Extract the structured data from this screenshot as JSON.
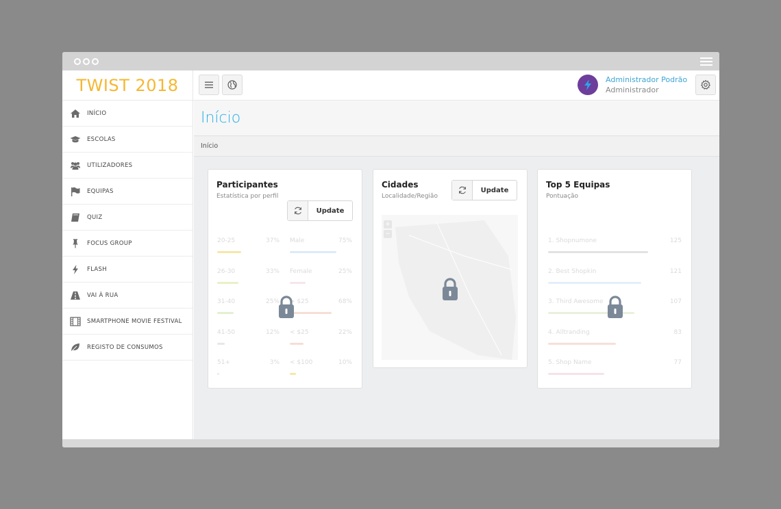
{
  "app": {
    "brand": "TWIST 2018"
  },
  "user": {
    "name": "Administrador Podrão",
    "role": "Administrador"
  },
  "sidebar": {
    "items": [
      {
        "label": "INÍCIO",
        "icon": "home-icon"
      },
      {
        "label": "ESCOLAS",
        "icon": "graduation-cap-icon"
      },
      {
        "label": "UTILIZADORES",
        "icon": "users-icon"
      },
      {
        "label": "EQUIPAS",
        "icon": "flag-icon"
      },
      {
        "label": "QUIZ",
        "icon": "book-icon"
      },
      {
        "label": "FOCUS GROUP",
        "icon": "pin-icon"
      },
      {
        "label": "FLASH",
        "icon": "bolt-icon"
      },
      {
        "label": "VAI À RUA",
        "icon": "road-icon"
      },
      {
        "label": "SMARTPHONE MOVIE FESTIVAL",
        "icon": "film-icon"
      },
      {
        "label": "REGISTO DE CONSUMOS",
        "icon": "leaf-icon"
      }
    ]
  },
  "page": {
    "title": "Início",
    "breadcrumb": "Início"
  },
  "cards": {
    "participantes": {
      "title": "Participantes",
      "subtitle": "Estatística por perfil",
      "update_label": "Update",
      "left": [
        {
          "label": "20-25",
          "value": "37%",
          "pct": 37,
          "color": "#f6e7a8"
        },
        {
          "label": "26-30",
          "value": "33%",
          "pct": 33,
          "color": "#e9f0c8"
        },
        {
          "label": "31-40",
          "value": "25%",
          "pct": 25,
          "color": "#e3f0d2"
        },
        {
          "label": "41-50",
          "value": "12%",
          "pct": 12,
          "color": "#e8e8e8"
        },
        {
          "label": "51+",
          "value": "3%",
          "pct": 3,
          "color": "#f0e6f2"
        }
      ],
      "right": [
        {
          "label": "Male",
          "value": "75%",
          "pct": 75,
          "color": "#dcebf7"
        },
        {
          "label": "Female",
          "value": "25%",
          "pct": 25,
          "color": "#f7e6ec"
        },
        {
          "label": "> $25",
          "value": "68%",
          "pct": 68,
          "color": "#f7ddd6"
        },
        {
          "label": "< $25",
          "value": "22%",
          "pct": 22,
          "color": "#f7ddd6"
        },
        {
          "label": "< $100",
          "value": "10%",
          "pct": 10,
          "color": "#f6e7a8"
        }
      ]
    },
    "cidades": {
      "title": "Cidades",
      "subtitle": "Localidade/Região",
      "update_label": "Update",
      "zoom_in": "+",
      "zoom_out": "−"
    },
    "top5": {
      "title": "Top 5 Equipas",
      "subtitle": "Pontuação",
      "rows": [
        {
          "label": "1. Shopnumone",
          "value": "125",
          "pct": 100,
          "color": "#e2e2e2"
        },
        {
          "label": "2. Best Shopkin",
          "value": "121",
          "pct": 93,
          "color": "#e3effa"
        },
        {
          "label": "3. Third Awesome",
          "value": "107",
          "pct": 86,
          "color": "#e8f1dc"
        },
        {
          "label": "4. Alltranding",
          "value": "83",
          "pct": 68,
          "color": "#f7e0da"
        },
        {
          "label": "5. Shop Name",
          "value": "77",
          "pct": 56,
          "color": "#f6e2ec"
        }
      ]
    }
  },
  "colors": {
    "brand": "#f5b731",
    "accent": "#2bb0e6",
    "lock": "#7b8898",
    "avatar": "#6d3e9b"
  }
}
